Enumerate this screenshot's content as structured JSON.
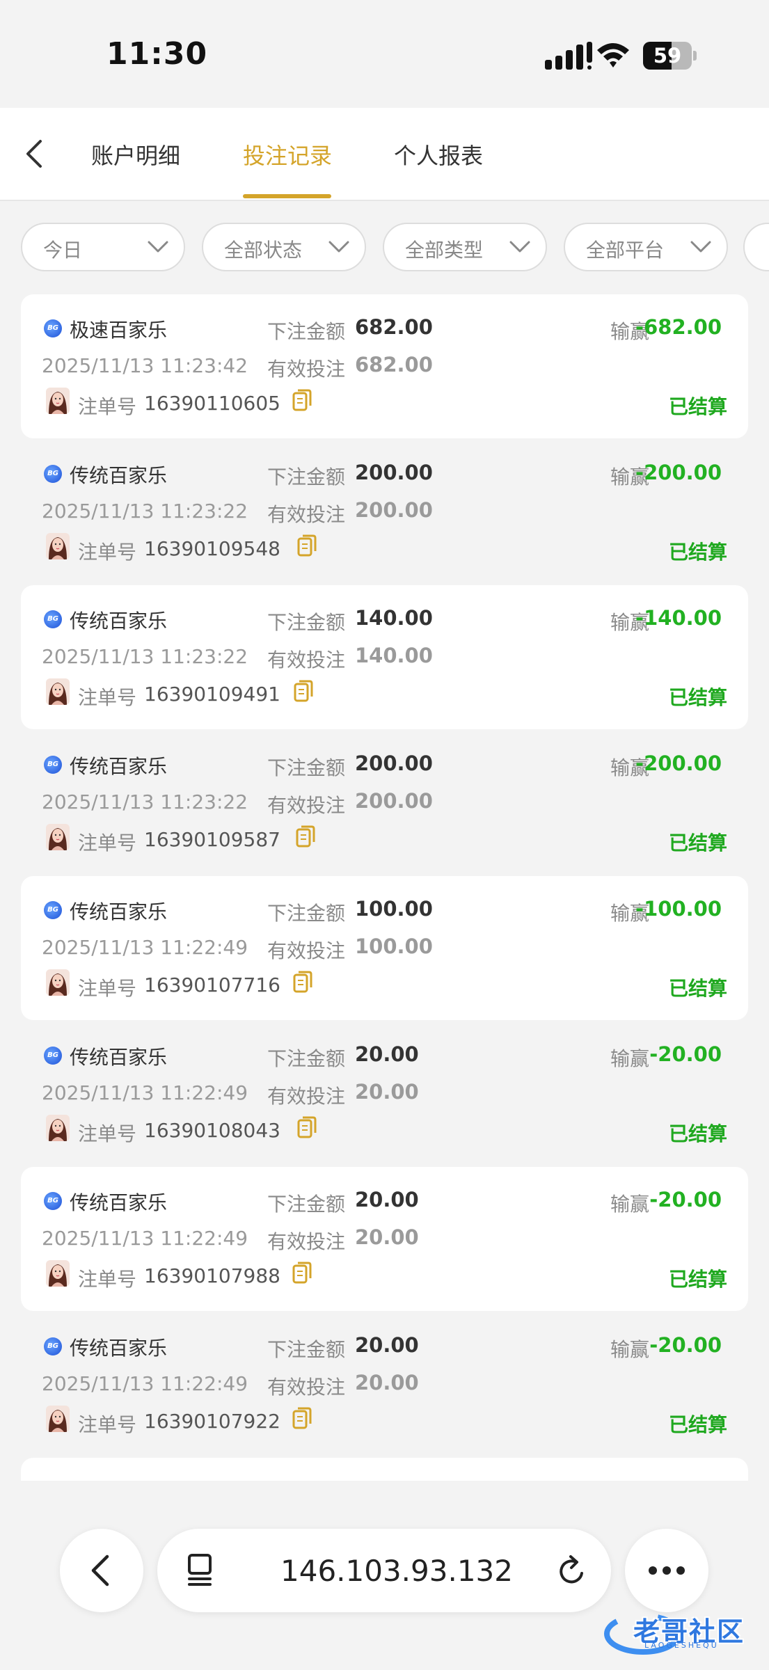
{
  "status_bar": {
    "time": "11:30",
    "battery": "59",
    "battery_level": 0.59
  },
  "header": {
    "tabs": [
      {
        "label": "账户明细",
        "active": false
      },
      {
        "label": "投注记录",
        "active": true
      },
      {
        "label": "个人报表",
        "active": false
      }
    ]
  },
  "filters": [
    {
      "label": "今日"
    },
    {
      "label": "全部状态"
    },
    {
      "label": "全部类型"
    },
    {
      "label": "全部平台"
    }
  ],
  "labels": {
    "bet_amount": "下注金额",
    "valid_bet": "有效投注",
    "win_loss": "输赢",
    "order_no": "注单号"
  },
  "records": [
    {
      "game": "极速百家乐",
      "bet": "682.00",
      "win": "-682.00",
      "date": "2025/11/13 11:23:42",
      "valid": "682.00",
      "order": "16390110605",
      "status": "已结算"
    },
    {
      "game": "传统百家乐",
      "bet": "200.00",
      "win": "-200.00",
      "date": "2025/11/13 11:23:22",
      "valid": "200.00",
      "order": "16390109548",
      "status": "已结算"
    },
    {
      "game": "传统百家乐",
      "bet": "140.00",
      "win": "-140.00",
      "date": "2025/11/13 11:23:22",
      "valid": "140.00",
      "order": "16390109491",
      "status": "已结算"
    },
    {
      "game": "传统百家乐",
      "bet": "200.00",
      "win": "-200.00",
      "date": "2025/11/13 11:23:22",
      "valid": "200.00",
      "order": "16390109587",
      "status": "已结算"
    },
    {
      "game": "传统百家乐",
      "bet": "100.00",
      "win": "-100.00",
      "date": "2025/11/13 11:22:49",
      "valid": "100.00",
      "order": "16390107716",
      "status": "已结算"
    },
    {
      "game": "传统百家乐",
      "bet": "20.00",
      "win": "-20.00",
      "date": "2025/11/13 11:22:49",
      "valid": "20.00",
      "order": "16390108043",
      "status": "已结算"
    },
    {
      "game": "传统百家乐",
      "bet": "20.00",
      "win": "-20.00",
      "date": "2025/11/13 11:22:49",
      "valid": "20.00",
      "order": "16390107988",
      "status": "已结算"
    },
    {
      "game": "传统百家乐",
      "bet": "20.00",
      "win": "-20.00",
      "date": "2025/11/13 11:22:49",
      "valid": "20.00",
      "order": "16390107922",
      "status": "已结算"
    }
  ],
  "browser": {
    "url": "146.103.93.132"
  },
  "watermark": {
    "text": "老哥社区",
    "sub": "LAOGESHEQU"
  },
  "colors": {
    "accent": "#d4a42a",
    "loss": "#22b122",
    "settled": "#1fa81f"
  },
  "icons": {
    "back": "chevron-left-icon",
    "filter": "chevron-down-icon",
    "platform": "bg-logo-icon",
    "copy": "copy-icon",
    "tabs": "tabs-icon",
    "reload": "reload-icon",
    "more": "more-icon"
  }
}
